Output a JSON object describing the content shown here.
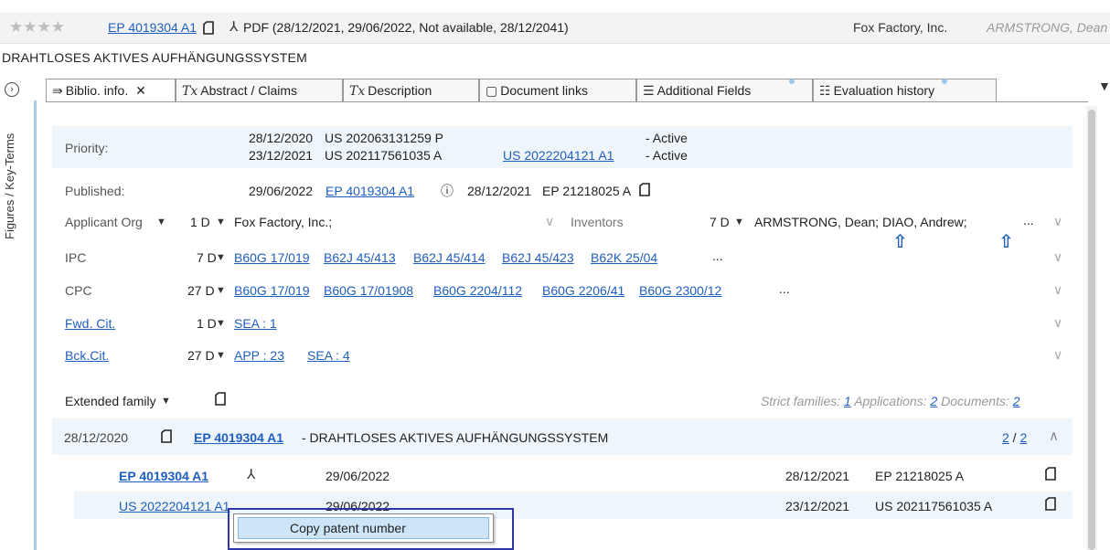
{
  "header": {
    "stars": "★★★★",
    "patent_number": "EP 4019304 A1",
    "pdf_label": "PDF",
    "pdf_dates": "(28/12/2021, 29/06/2022, Not available, 28/12/2041)",
    "company": "Fox Factory, Inc.",
    "inventor": "ARMSTRONG, Dean"
  },
  "subtitle": "DRAHTLOSES AKTIVES AUFHÄNGUNGSSYSTEM",
  "sidebar": {
    "vertical_label": "Figures / Key-Terms"
  },
  "tabs": [
    {
      "label": "Biblio. info.",
      "close": "✕"
    },
    {
      "label": "Abstract / Claims"
    },
    {
      "label": "Description"
    },
    {
      "label": "Document links"
    },
    {
      "label": "Additional Fields"
    },
    {
      "label": "Evaluation history"
    }
  ],
  "biblio": {
    "priority_label": "Priority:",
    "priority": [
      {
        "date": "28/12/2020",
        "number": "US 202063131259 P",
        "link": "",
        "status": "- Active"
      },
      {
        "date": "23/12/2021",
        "number": "US 202117561035 A",
        "link": "US 2022204121 A1",
        "status": "- Active"
      }
    ],
    "published_label": "Published:",
    "published_date": "29/06/2022",
    "published_number": "EP 4019304 A1",
    "published_app_date": "28/12/2021",
    "published_app_number": "EP 21218025 A",
    "applicant_label": "Applicant Org",
    "applicant_count": "1 D",
    "applicant_value": "Fox Factory, Inc.;",
    "inventors_label": "Inventors",
    "inventors_count": "7 D",
    "inventors_value": "ARMSTRONG, Dean;  DIAO, Andrew;",
    "inventors_more": "...",
    "ipc_label": "IPC",
    "ipc_count": "7 D",
    "ipc_codes": [
      "B60G 17/019",
      "B62J 45/413",
      "B62J 45/414",
      "B62J 45/423",
      "B62K 25/04"
    ],
    "ipc_more": "...",
    "cpc_label": "CPC",
    "cpc_count": "27 D",
    "cpc_codes": [
      "B60G 17/019",
      "B60G 17/01908",
      "B60G 2204/112",
      "B60G 2206/41",
      "B60G 2300/12"
    ],
    "cpc_more": "...",
    "fwd_label": "Fwd. Cit.",
    "fwd_count": "1 D",
    "fwd_values": [
      "SEA : 1"
    ],
    "bck_label": "Bck.Cit.",
    "bck_count": "27 D",
    "bck_values": [
      "APP : 23",
      "SEA : 4"
    ]
  },
  "family": {
    "label": "Extended family",
    "strict_label": "Strict families:",
    "strict_value": "1",
    "applications_label": "Applications:",
    "applications_value": "2",
    "documents_label": "Documents:",
    "documents_value": "2",
    "group_date": "28/12/2020",
    "group_number": "EP 4019304 A1",
    "group_title": " - DRAHTLOSES AKTIVES AUFHÄNGUNGSSYSTEM",
    "group_page": "2",
    "group_total": "2",
    "rows": [
      {
        "number": "EP 4019304 A1",
        "pub_date": "29/06/2022",
        "app_date": "28/12/2021",
        "app_number": "EP 21218025 A"
      },
      {
        "number": "US 2022204121 A1",
        "pub_date": "29/06/2022",
        "app_date": "23/12/2021",
        "app_number": "US 202117561035 A"
      }
    ]
  },
  "context_menu": {
    "item": "Copy patent number"
  },
  "colors": {
    "link": "#1f5fbf",
    "highlight": "#eef5fb",
    "menu_outline": "#2f37a8"
  }
}
